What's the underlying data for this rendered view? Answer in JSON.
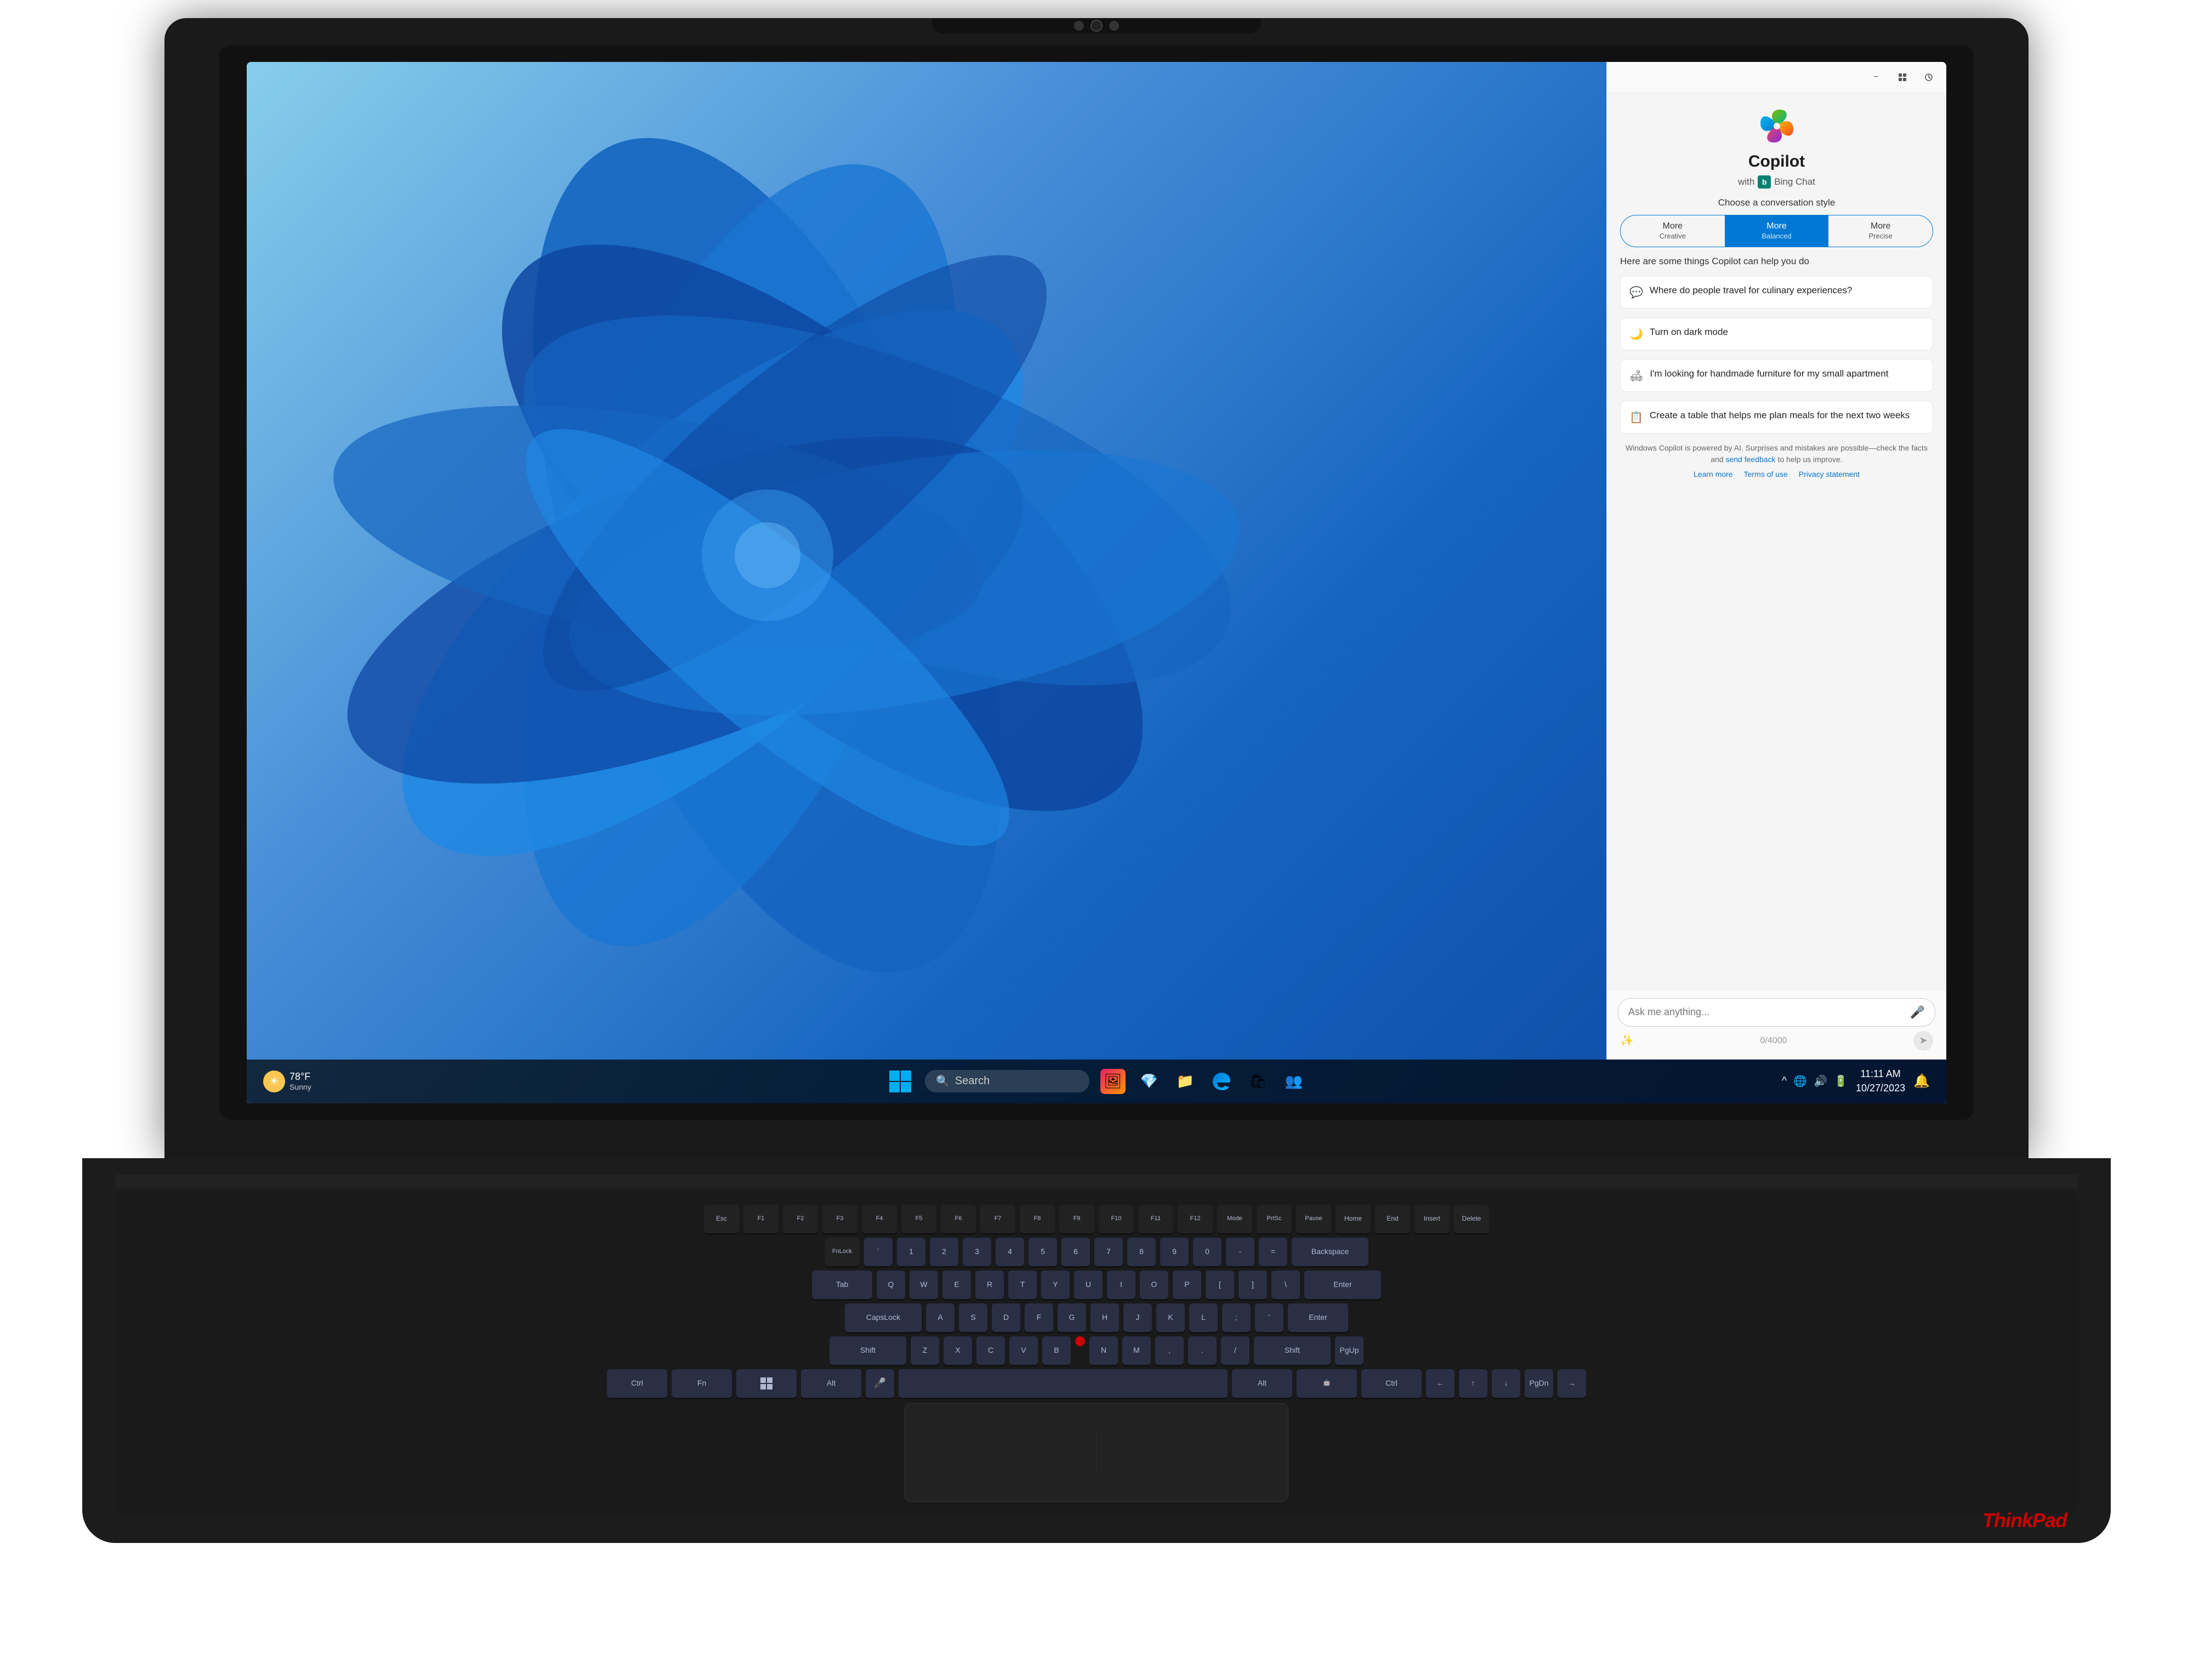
{
  "laptop": {
    "brand": "ThinkPad"
  },
  "screen": {
    "taskbar": {
      "weather": {
        "temp": "78°F",
        "condition": "Sunny"
      },
      "search_placeholder": "Search",
      "clock": {
        "time": "11:11 AM",
        "date": "10/27/2023"
      }
    }
  },
  "copilot": {
    "title": "Copilot",
    "subtitle": "with",
    "bing_chat": "Bing Chat",
    "header": {
      "minimize": "−",
      "grid": "⊞",
      "history": "↺"
    },
    "conversation_style": {
      "label": "Choose a conversation style",
      "options": [
        {
          "id": "creative",
          "label": "More",
          "sublabel": "Creative"
        },
        {
          "id": "balanced",
          "label": "More",
          "sublabel": "Balanced",
          "active": true
        },
        {
          "id": "precise",
          "label": "More",
          "sublabel": "Precise"
        }
      ]
    },
    "suggestions_intro": "Here are some things Copilot can help you do",
    "suggestions": [
      {
        "icon": "💬",
        "text": "Where do people travel for culinary experiences?"
      },
      {
        "icon": "🌙",
        "text": "Turn on dark mode"
      },
      {
        "icon": "🛋",
        "text": "I'm looking for handmade furniture for my small apartment"
      },
      {
        "icon": "📋",
        "text": "Create a table that helps me plan meals for the next two weeks"
      }
    ],
    "disclaimer": {
      "text": "Windows Copilot is powered by AI. Surprises and mistakes are possible—check the facts and",
      "link_text": "send feedback",
      "text2": "to help us improve.",
      "links": [
        "Learn more",
        "Terms of use",
        "Privacy statement"
      ]
    },
    "input": {
      "placeholder": "Ask me anything...",
      "char_count": "0/4000"
    }
  }
}
